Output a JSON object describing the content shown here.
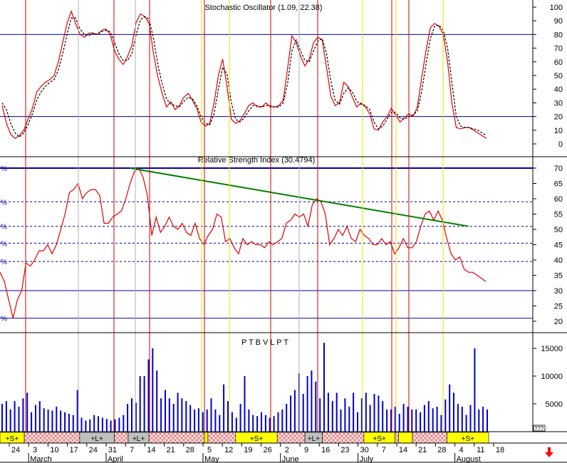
{
  "app": {
    "colors": {
      "background": "#ffffff",
      "frame": "#000000",
      "hline": "#0000a0",
      "stoch": "#e00000",
      "signal": "#000000",
      "vline_red": "#cc0000",
      "vline_yellow": "#e6e600",
      "vline_gray": "#b0b0b0",
      "trendline": "#008000",
      "volume": "#0000cc",
      "band_yellow": "#ffff00",
      "band_hatch": "#e06060",
      "band_gray": "#c0c0c0",
      "arrow": "#ff0000"
    },
    "arrow_icon": "down-arrow-icon"
  },
  "chart_data": [
    {
      "type": "line",
      "title": "Stochastic Oscillator (1.09, 22.38)",
      "ylim": [
        -10,
        103
      ],
      "yticks": [
        "100",
        "90",
        "80",
        "70",
        "60",
        "50",
        "40",
        "30",
        "20",
        "10",
        "0"
      ],
      "hlines": [
        80,
        20
      ],
      "series": [
        {
          "values": [
            28,
            15,
            7,
            4,
            6,
            10,
            18,
            26,
            38,
            42,
            45,
            47,
            50,
            60,
            74,
            88,
            97,
            88,
            80,
            78,
            81,
            81,
            80,
            83,
            84,
            80,
            68,
            62,
            58,
            64,
            72,
            89,
            95,
            93,
            88,
            66,
            49,
            37,
            27,
            31,
            25,
            28,
            34,
            37,
            32,
            26,
            16,
            13,
            15,
            30,
            50,
            62,
            42,
            18,
            15,
            17,
            22,
            28,
            30,
            27,
            27,
            30,
            27,
            27,
            28,
            32,
            55,
            79,
            74,
            64,
            57,
            62,
            74,
            78,
            76,
            56,
            35,
            28,
            30,
            45,
            42,
            34,
            27,
            30,
            27,
            22,
            11,
            10,
            16,
            20,
            26,
            21,
            16,
            19,
            22,
            20,
            27,
            48,
            68,
            85,
            88,
            86,
            80,
            60,
            30,
            12,
            11,
            12,
            12,
            10,
            8,
            6,
            4
          ]
        },
        {
          "values": [
            30,
            25,
            15,
            8,
            5,
            8,
            14,
            22,
            32,
            38,
            42,
            45,
            47,
            54,
            66,
            80,
            92,
            92,
            84,
            80,
            79,
            81,
            80,
            82,
            83,
            82,
            74,
            66,
            61,
            61,
            66,
            80,
            91,
            93,
            91,
            77,
            58,
            44,
            33,
            29,
            28,
            27,
            31,
            34,
            33,
            28,
            20,
            15,
            14,
            22,
            40,
            56,
            51,
            30,
            18,
            16,
            19,
            24,
            28,
            28,
            27,
            28,
            28,
            27,
            27,
            30,
            44,
            68,
            76,
            68,
            61,
            60,
            68,
            75,
            77,
            66,
            46,
            32,
            29,
            37,
            41,
            38,
            31,
            29,
            28,
            25,
            16,
            11,
            13,
            18,
            23,
            23,
            19,
            18,
            20,
            21,
            24,
            38,
            58,
            77,
            86,
            87,
            83,
            70,
            45,
            20,
            13,
            12,
            12,
            11,
            10,
            8,
            6
          ]
        }
      ]
    },
    {
      "type": "line",
      "title": "Relative Strength Index (30.4794)",
      "ylim": [
        18,
        72
      ],
      "yticks": [
        "70",
        "65",
        "60",
        "55",
        "50",
        "45",
        "40",
        "35",
        "30",
        "25",
        "20"
      ],
      "hlines_solid": [
        70,
        30,
        21
      ],
      "hlines_dashed": [
        59,
        51,
        45.5,
        39.5
      ],
      "left_labels": [
        "%",
        "%",
        "%",
        "%",
        "%",
        "%"
      ],
      "trendline": {
        "from_index": 30,
        "from_value": 70,
        "to_index": 108,
        "to_value": 51
      },
      "series": [
        {
          "values": [
            36,
            33,
            27,
            21,
            27,
            30,
            39,
            38,
            40,
            43,
            43,
            45,
            42,
            45,
            50,
            55,
            62,
            63,
            65,
            60,
            62,
            63,
            63,
            61,
            52,
            52,
            54,
            55,
            56,
            60,
            65,
            69,
            70,
            67,
            61,
            48,
            54,
            49,
            51,
            54,
            51,
            50,
            52,
            49,
            48,
            52,
            47,
            45,
            48,
            50,
            55,
            54,
            46,
            47,
            44,
            42,
            47,
            45,
            46,
            45,
            45,
            44,
            46,
            45,
            46,
            47,
            52,
            53,
            55,
            54,
            55,
            51,
            58,
            60,
            59,
            55,
            45,
            47,
            50,
            48,
            51,
            47,
            46,
            50,
            48,
            47,
            45,
            45,
            47,
            45,
            46,
            42,
            44,
            47,
            44,
            44,
            46,
            51,
            55,
            56,
            53,
            56,
            53,
            47,
            42,
            40,
            41,
            37,
            36,
            36,
            35,
            34,
            33
          ]
        }
      ]
    },
    {
      "type": "bar",
      "title": "P T B V L P T",
      "ylim": [
        0,
        17000
      ],
      "yticks": [
        "15000",
        "10000",
        "5000"
      ],
      "series": [
        {
          "values": [
            5000,
            5500,
            4000,
            5500,
            4500,
            6000,
            7000,
            3500,
            4800,
            5500,
            4200,
            4000,
            3800,
            4500,
            3800,
            3500,
            3200,
            3000,
            7500,
            2500,
            2000,
            2200,
            3000,
            2800,
            2500,
            2300,
            2000,
            2200,
            2500,
            3000,
            5000,
            6000,
            5200,
            10000,
            10000,
            13000,
            15000,
            11000,
            6000,
            7500,
            6000,
            5000,
            7000,
            6000,
            5500,
            4800,
            4000,
            4200,
            3500,
            4000,
            6000,
            4000,
            3000,
            8500,
            5500,
            3500,
            2500,
            5000,
            10000,
            4000,
            3000,
            2800,
            3500,
            3000,
            2500,
            2800,
            3500,
            4000,
            5000,
            6500,
            7500,
            10500,
            6800,
            10000,
            11000,
            9000,
            6000,
            16000,
            7000,
            5500,
            7000,
            4000,
            6000,
            4500,
            7000,
            3500,
            6000,
            7000,
            4800,
            6800,
            6500,
            5500,
            4000,
            4000,
            4500,
            3200,
            5000,
            4500,
            4000,
            4000,
            3500,
            4800,
            5500,
            4200,
            4500,
            3000,
            5800,
            8500,
            7000,
            5000,
            4500,
            3000,
            4800,
            15000,
            4000,
            4500,
            4000
          ]
        }
      ],
      "bands": [
        {
          "type": "yellow",
          "label": "+S+",
          "start": 0,
          "end": 7
        },
        {
          "type": "hatch",
          "label": "",
          "start": 7,
          "end": 23
        },
        {
          "type": "gray",
          "label": "+L+",
          "start": 23,
          "end": 33
        },
        {
          "type": "hatch",
          "label": "",
          "start": 33,
          "end": 37
        },
        {
          "type": "gray",
          "label": "+L+",
          "start": 37,
          "end": 43
        },
        {
          "type": "hatch",
          "label": "",
          "start": 43,
          "end": 59
        },
        {
          "type": "yellow",
          "label": "",
          "start": 59,
          "end": 60
        },
        {
          "type": "hatch",
          "label": "",
          "start": 60,
          "end": 68
        },
        {
          "type": "yellow",
          "label": "+S+",
          "start": 68,
          "end": 80
        },
        {
          "type": "hatch",
          "label": "",
          "start": 80,
          "end": 88
        },
        {
          "type": "gray",
          "label": "+L+",
          "start": 88,
          "end": 93
        },
        {
          "type": "hatch",
          "label": "",
          "start": 93,
          "end": 105
        },
        {
          "type": "yellow",
          "label": "+S+",
          "start": 105,
          "end": 114
        },
        {
          "type": "hatch",
          "label": "",
          "start": 114,
          "end": 115
        },
        {
          "type": "yellow",
          "label": "",
          "start": 115,
          "end": 119
        },
        {
          "type": "hatch",
          "label": "",
          "start": 119,
          "end": 129
        },
        {
          "type": "yellow",
          "label": "+S+",
          "start": 129,
          "end": 141
        }
      ]
    }
  ],
  "x_axis": {
    "day_labels": [
      "24",
      "3",
      "10",
      "17",
      "24",
      "31",
      "7",
      "14",
      "21",
      "28",
      "5",
      "12",
      "19",
      "26",
      "2",
      "9",
      "16",
      "23",
      "30",
      "7",
      "14",
      "21",
      "28",
      "4",
      "11",
      "18"
    ],
    "month_labels": [
      "March",
      "April",
      "May",
      "June",
      "July",
      "August"
    ],
    "box_label": "???"
  }
}
